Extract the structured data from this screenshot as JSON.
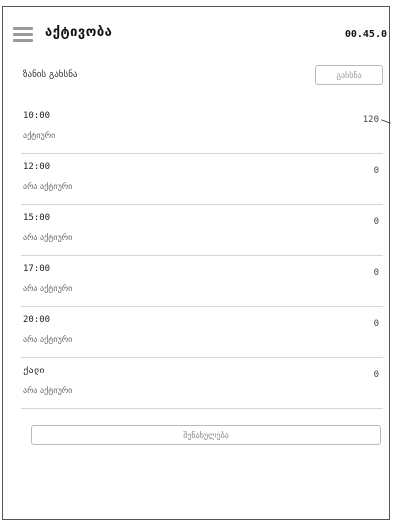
{
  "header": {
    "title": "აქტივობა",
    "balance": "00.45.0"
  },
  "price": {
    "label": "ზანის გახსნა",
    "button_label": "გახსნა"
  },
  "slots": [
    {
      "time": "10:00",
      "status": "აქტიური",
      "count": "120"
    },
    {
      "time": "12:00",
      "status": "არა აქტიური",
      "count": "0"
    },
    {
      "time": "15:00",
      "status": "არა აქტიური",
      "count": "0"
    },
    {
      "time": "17:00",
      "status": "არა აქტიური",
      "count": "0"
    },
    {
      "time": "20:00",
      "status": "არა აქტიური",
      "count": "0"
    },
    {
      "time": "ქალი",
      "status": "არა აქტიური",
      "count": "0"
    }
  ],
  "footer": {
    "save_label": "შენახულება"
  }
}
